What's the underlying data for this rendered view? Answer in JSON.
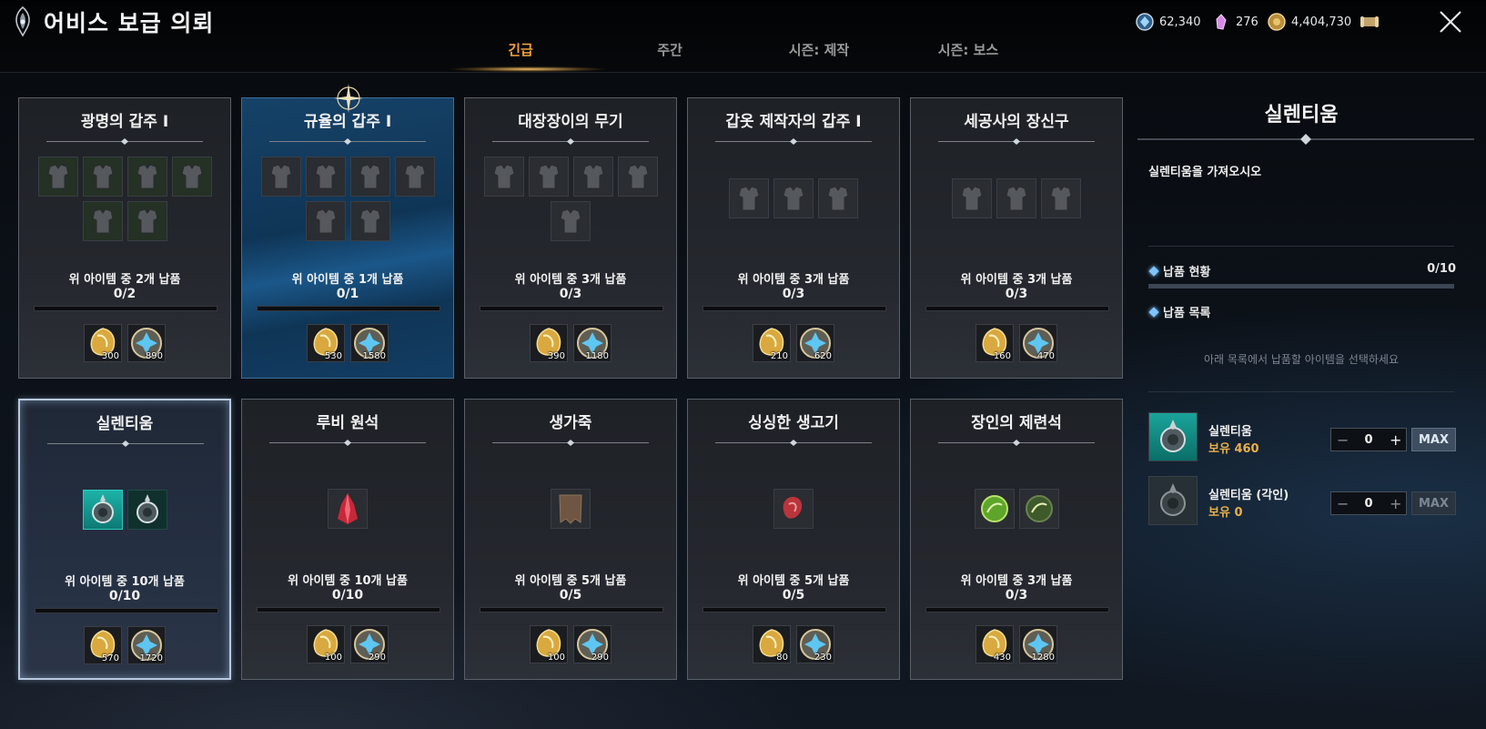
{
  "header": {
    "title": "어비스 보급 의뢰",
    "tabs": [
      {
        "label": "긴급",
        "active": true
      },
      {
        "label": "주간",
        "active": false
      },
      {
        "label": "시즌: 제작",
        "active": false
      },
      {
        "label": "시즌: 보스",
        "active": false
      }
    ],
    "currencies": [
      {
        "icon": "blue-gem-coin-icon",
        "value": "62,340",
        "color": "#6fa7d8"
      },
      {
        "icon": "pink-crystal-icon",
        "value": "276",
        "color": "#d888e8"
      },
      {
        "icon": "gold-coin-icon",
        "value": "4,404,730",
        "color": "#d7b060"
      }
    ],
    "extra_icon": "scroll-icon",
    "close_icon": "close-icon"
  },
  "cards": [
    {
      "title": "광명의 갑주 Ⅰ",
      "style": "normal",
      "items": 6,
      "item_style": "dim",
      "deliver": "위 아이템 중 2개 납품",
      "progress": "0/2",
      "rewards": [
        "300",
        "890"
      ]
    },
    {
      "title": "규율의 갑주 Ⅰ",
      "style": "blue",
      "items": 6,
      "item_style": "normal",
      "deliver": "위 아이템 중 1개 납품",
      "progress": "0/1",
      "rewards": [
        "530",
        "1580"
      ]
    },
    {
      "title": "대장장이의 무기",
      "style": "normal",
      "items": 5,
      "item_style": "normal",
      "deliver": "위 아이템 중 3개 납품",
      "progress": "0/3",
      "rewards": [
        "390",
        "1180"
      ]
    },
    {
      "title": "갑옷 제작자의 갑주 Ⅰ",
      "style": "normal",
      "items": 3,
      "item_style": "normal",
      "deliver": "위 아이템 중 3개 납품",
      "progress": "0/3",
      "rewards": [
        "210",
        "620"
      ]
    },
    {
      "title": "세공사의 장신구",
      "style": "normal",
      "items": 3,
      "item_style": "normal",
      "deliver": "위 아이템 중 3개 납품",
      "progress": "0/3",
      "rewards": [
        "160",
        "470"
      ]
    },
    {
      "title": "실렌티움",
      "style": "selected",
      "items": 2,
      "item_style": "teal",
      "deliver": "위 아이템 중 10개 납품",
      "progress": "0/10",
      "rewards": [
        "570",
        "1720"
      ]
    },
    {
      "title": "루비 원석",
      "style": "normal",
      "items": 1,
      "item_style": "ruby",
      "deliver": "위 아이템 중 10개 납품",
      "progress": "0/10",
      "rewards": [
        "100",
        "290"
      ]
    },
    {
      "title": "생가죽",
      "style": "normal",
      "items": 1,
      "item_style": "leather",
      "deliver": "위 아이템 중 5개 납품",
      "progress": "0/5",
      "rewards": [
        "100",
        "290"
      ]
    },
    {
      "title": "싱싱한 생고기",
      "style": "normal",
      "items": 1,
      "item_style": "meat",
      "deliver": "위 아이템 중 5개 납품",
      "progress": "0/5",
      "rewards": [
        "80",
        "230"
      ]
    },
    {
      "title": "장인의 제련석",
      "style": "normal",
      "items": 2,
      "item_style": "green",
      "deliver": "위 아이템 중 3개 납품",
      "progress": "0/3",
      "rewards": [
        "430",
        "1280"
      ]
    }
  ],
  "panel": {
    "title": "실렌티움",
    "description": "실렌티움을 가져오시오",
    "status_label": "납품 현황",
    "status_value": "0/10",
    "list_label": "납품 목록",
    "hint": "아래 목록에서 납품할 아이템을 선택하세요",
    "materials": [
      {
        "name": "실렌티움",
        "own": "보유 460",
        "qty": "0",
        "max_label": "MAX",
        "enabled": true
      },
      {
        "name": "실렌티움 (각인)",
        "own": "보유 0",
        "qty": "0",
        "max_label": "MAX",
        "enabled": false
      }
    ]
  }
}
